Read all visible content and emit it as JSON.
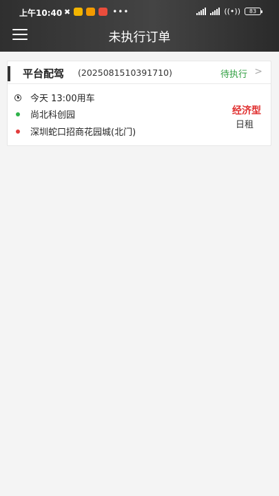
{
  "status_bar": {
    "time": "上午10:40",
    "battery": "83",
    "app_icon_colors": [
      "#f2b400",
      "#f29a00",
      "#ea4d3c"
    ]
  },
  "header": {
    "title": "未执行订单"
  },
  "order": {
    "service_type": "平台配驾",
    "order_no": "(2025081510391710)",
    "status": "待执行",
    "status_color": "#2e9e3f",
    "time": "今天 13:00用车",
    "start": "尚北科创园",
    "start_color": "#2fb24a",
    "end": "深圳蛇口招商花园城(北门)",
    "end_color": "#e23c3c",
    "vehicle_class": "经济型",
    "vehicle_class_color": "#e02f2f",
    "rental": "日租"
  }
}
